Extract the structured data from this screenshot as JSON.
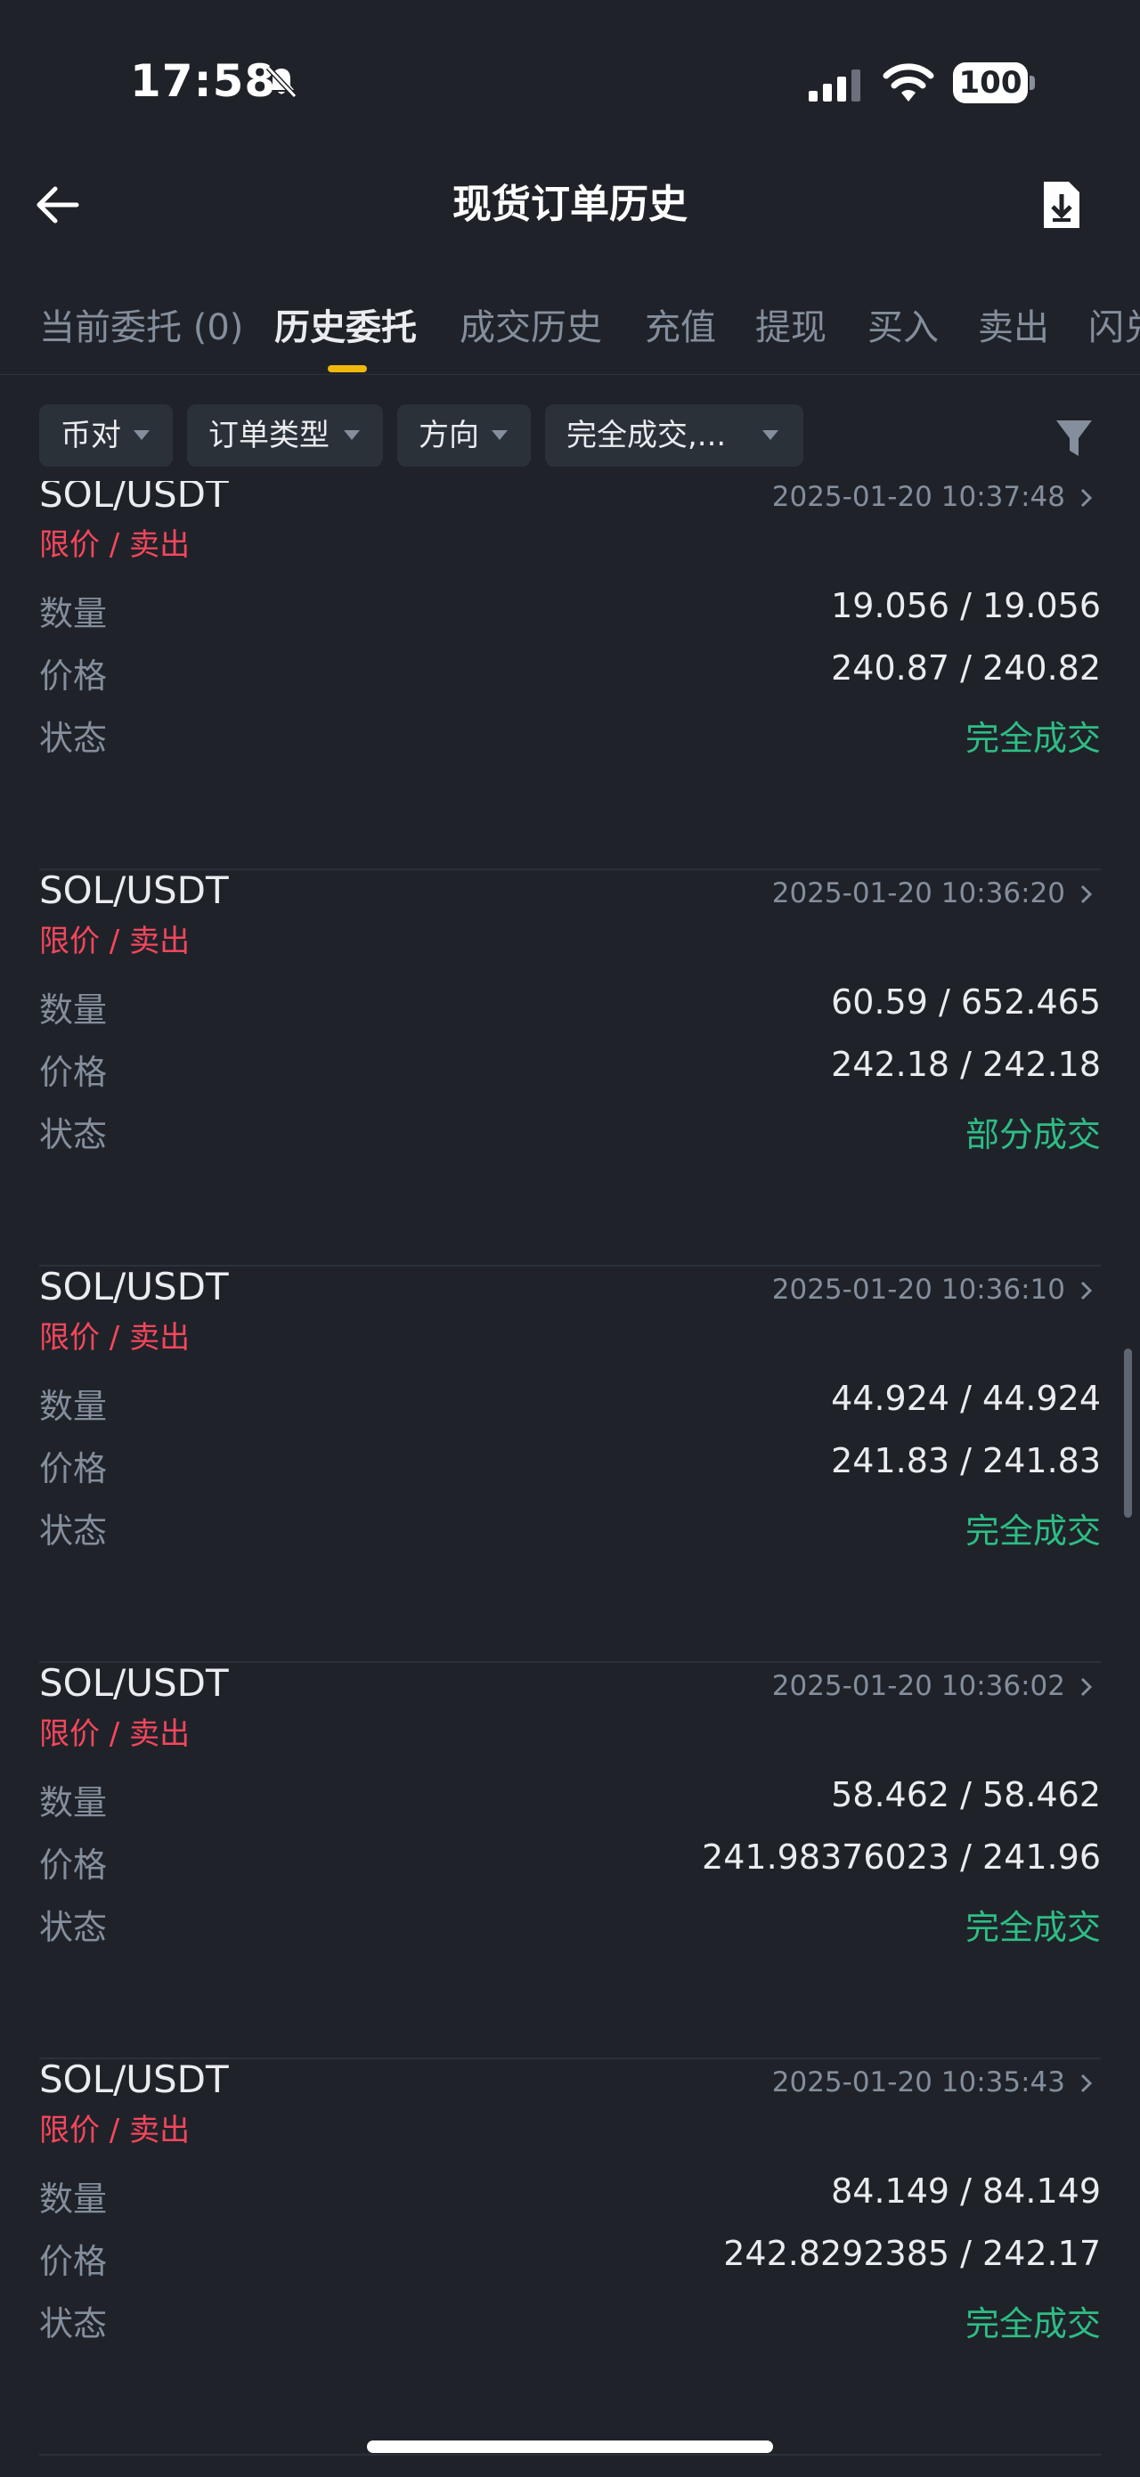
{
  "status_bar": {
    "time": "17:58",
    "battery": "100"
  },
  "header": {
    "title": "现货订单历史",
    "back_icon": "arrow-left-icon",
    "export_icon": "download-document-icon"
  },
  "tabs": [
    {
      "label": "当前委托 (0)",
      "active": false
    },
    {
      "label": "历史委托",
      "active": true
    },
    {
      "label": "成交历史",
      "active": false
    },
    {
      "label": "充值",
      "active": false
    },
    {
      "label": "提现",
      "active": false
    },
    {
      "label": "买入",
      "active": false
    },
    {
      "label": "卖出",
      "active": false
    },
    {
      "label": "闪兑",
      "active": false
    }
  ],
  "filters": {
    "pair_label": "币对",
    "type_label": "订单类型",
    "direction_label": "方向",
    "status_label": "完全成交,...",
    "filter_icon": "funnel-icon"
  },
  "row_labels": {
    "quantity": "数量",
    "price": "价格",
    "status": "状态"
  },
  "orders": [
    {
      "pair": "SOL/USDT",
      "side": "限价 / 卖出",
      "datetime": "2025-01-20 10:37:48",
      "quantity": "19.056 / 19.056",
      "price": "240.87 / 240.82",
      "status": "完全成交"
    },
    {
      "pair": "SOL/USDT",
      "side": "限价 / 卖出",
      "datetime": "2025-01-20 10:36:20",
      "quantity": "60.59 / 652.465",
      "price": "242.18 / 242.18",
      "status": "部分成交"
    },
    {
      "pair": "SOL/USDT",
      "side": "限价 / 卖出",
      "datetime": "2025-01-20 10:36:10",
      "quantity": "44.924 / 44.924",
      "price": "241.83 / 241.83",
      "status": "完全成交"
    },
    {
      "pair": "SOL/USDT",
      "side": "限价 / 卖出",
      "datetime": "2025-01-20 10:36:02",
      "quantity": "58.462 / 58.462",
      "price": "241.98376023 / 241.96",
      "status": "完全成交"
    },
    {
      "pair": "SOL/USDT",
      "side": "限价 / 卖出",
      "datetime": "2025-01-20 10:35:43",
      "quantity": "84.149 / 84.149",
      "price": "242.8292385 / 242.17",
      "status": "完全成交"
    }
  ],
  "colors": {
    "background": "#1f2329",
    "accent": "#f0b90b",
    "sell": "#f6465d",
    "filled": "#2ebd85",
    "muted": "#848e9c"
  }
}
